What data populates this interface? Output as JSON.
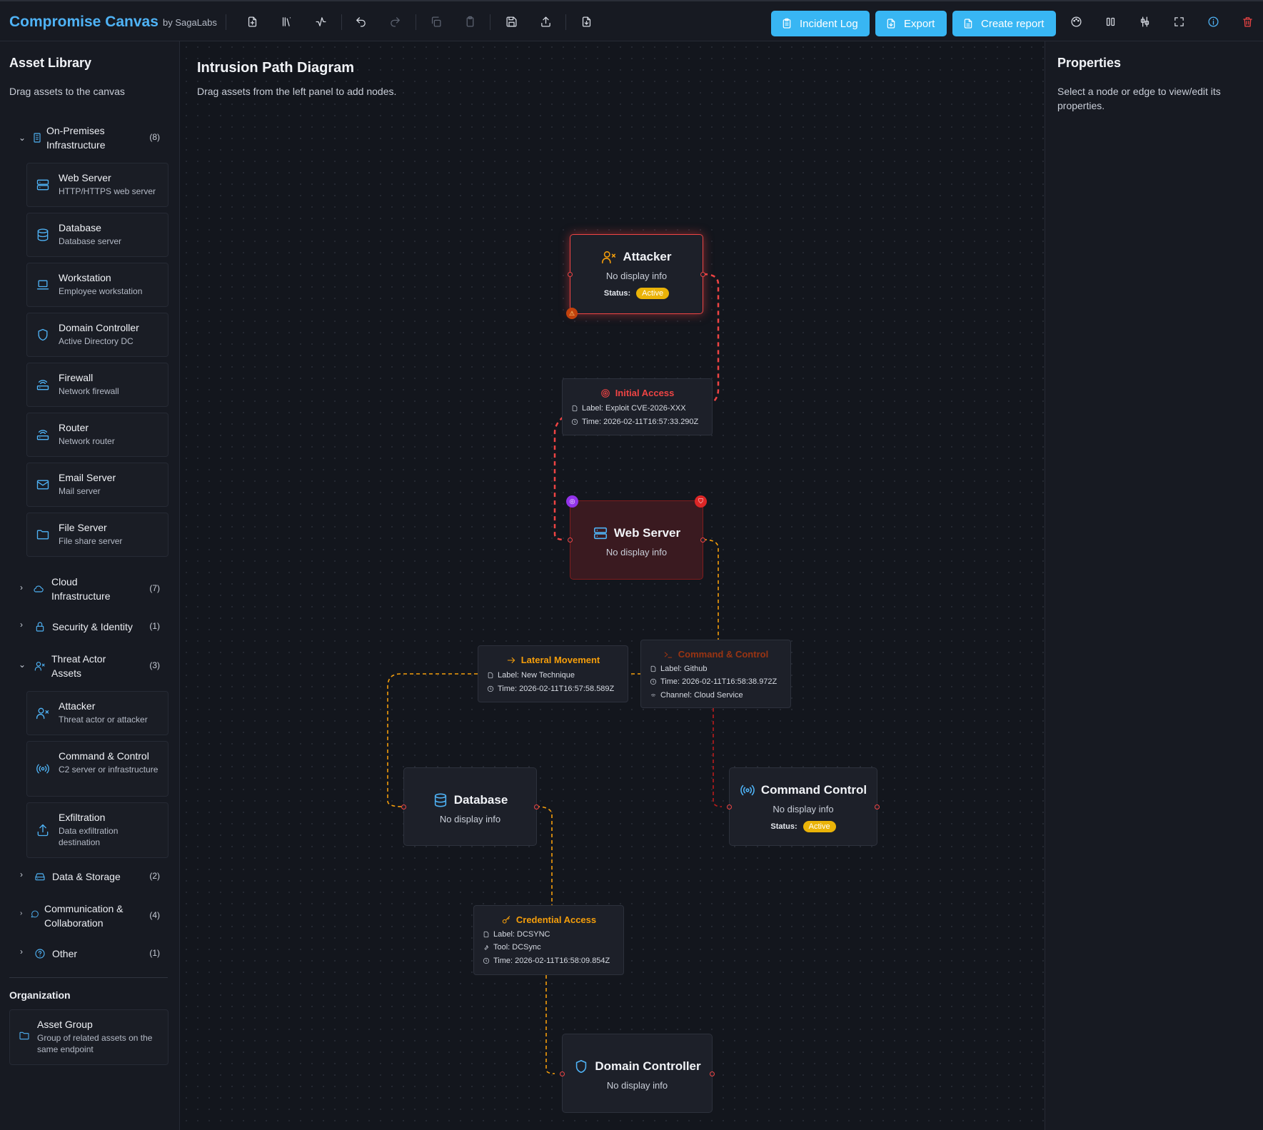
{
  "app": {
    "title": "Compromise Canvas",
    "byline": "by SagaLabs"
  },
  "toolbar": {
    "incident_log": "Incident Log",
    "export": "Export",
    "create_report": "Create report"
  },
  "sidebar": {
    "title": "Asset Library",
    "subtitle": "Drag assets to the canvas",
    "categories": [
      {
        "label": "On-Premises Infrastructure",
        "count": "(8)"
      },
      {
        "label": "Cloud Infrastructure",
        "count": "(7)"
      },
      {
        "label": "Security & Identity",
        "count": "(1)"
      },
      {
        "label": "Threat Actor Assets",
        "count": "(3)"
      },
      {
        "label": "Data & Storage",
        "count": "(2)"
      },
      {
        "label": "Communication & Collaboration",
        "count": "(4)"
      },
      {
        "label": "Other",
        "count": "(1)"
      }
    ],
    "onprem_assets": [
      {
        "name": "Web Server",
        "desc": "HTTP/HTTPS web server",
        "icon": "server-icon"
      },
      {
        "name": "Database",
        "desc": "Database server",
        "icon": "database-icon"
      },
      {
        "name": "Workstation",
        "desc": "Employee workstation",
        "icon": "laptop-icon"
      },
      {
        "name": "Domain Controller",
        "desc": "Active Directory DC",
        "icon": "shield-icon"
      },
      {
        "name": "Firewall",
        "desc": "Network firewall",
        "icon": "router-icon"
      },
      {
        "name": "Router",
        "desc": "Network router",
        "icon": "router-icon"
      },
      {
        "name": "Email Server",
        "desc": "Mail server",
        "icon": "mail-icon"
      },
      {
        "name": "File Server",
        "desc": "File share server",
        "icon": "folder-icon"
      }
    ],
    "threat_assets": [
      {
        "name": "Attacker",
        "desc": "Threat actor or attacker",
        "icon": "user-x-icon"
      },
      {
        "name": "Command & Control",
        "desc": "C2 server or infrastructure",
        "icon": "radio-icon"
      },
      {
        "name": "Exfiltration",
        "desc": "Data exfiltration destination",
        "icon": "upload-icon"
      }
    ],
    "organization": {
      "title": "Organization",
      "item": {
        "name": "Asset Group",
        "desc": "Group of related assets on the same endpoint"
      }
    }
  },
  "canvas": {
    "title": "Intrusion Path Diagram",
    "subtitle": "Drag assets from the left panel to add nodes.",
    "status_label": "Status:",
    "nodes": {
      "attacker": {
        "label": "Attacker",
        "info": "No display info",
        "status": "Active"
      },
      "webserver": {
        "label": "Web Server",
        "info": "No display info"
      },
      "database": {
        "label": "Database",
        "info": "No display info"
      },
      "c2": {
        "label": "Command Control",
        "info": "No display info",
        "status": "Active"
      },
      "dc": {
        "label": "Domain Controller",
        "info": "No display info"
      }
    },
    "edges": {
      "initial_access": {
        "title": "Initial Access",
        "label": "Label: Exploit CVE-2026-XXX",
        "time": "Time: 2026-02-11T16:57:33.290Z"
      },
      "lateral": {
        "title": "Lateral Movement",
        "label": "Label: New Technique",
        "time": "Time: 2026-02-11T16:57:58.589Z"
      },
      "c2": {
        "title": "Command & Control",
        "label": "Label: Github",
        "time": "Time: 2026-02-11T16:58:38.972Z",
        "channel": "Channel: Cloud Service"
      },
      "cred": {
        "title": "Credential Access",
        "label": "Label: DCSYNC",
        "tool": "Tool: DCSync",
        "time": "Time: 2026-02-11T16:58:09.854Z"
      }
    }
  },
  "properties": {
    "title": "Properties",
    "hint": "Select a node or edge to view/edit its properties."
  },
  "colors": {
    "accent": "#38b6f3",
    "brand": "#4fb3f6",
    "danger": "#ef4444",
    "warning": "#f59e0b",
    "active_badge": "#eab308"
  }
}
